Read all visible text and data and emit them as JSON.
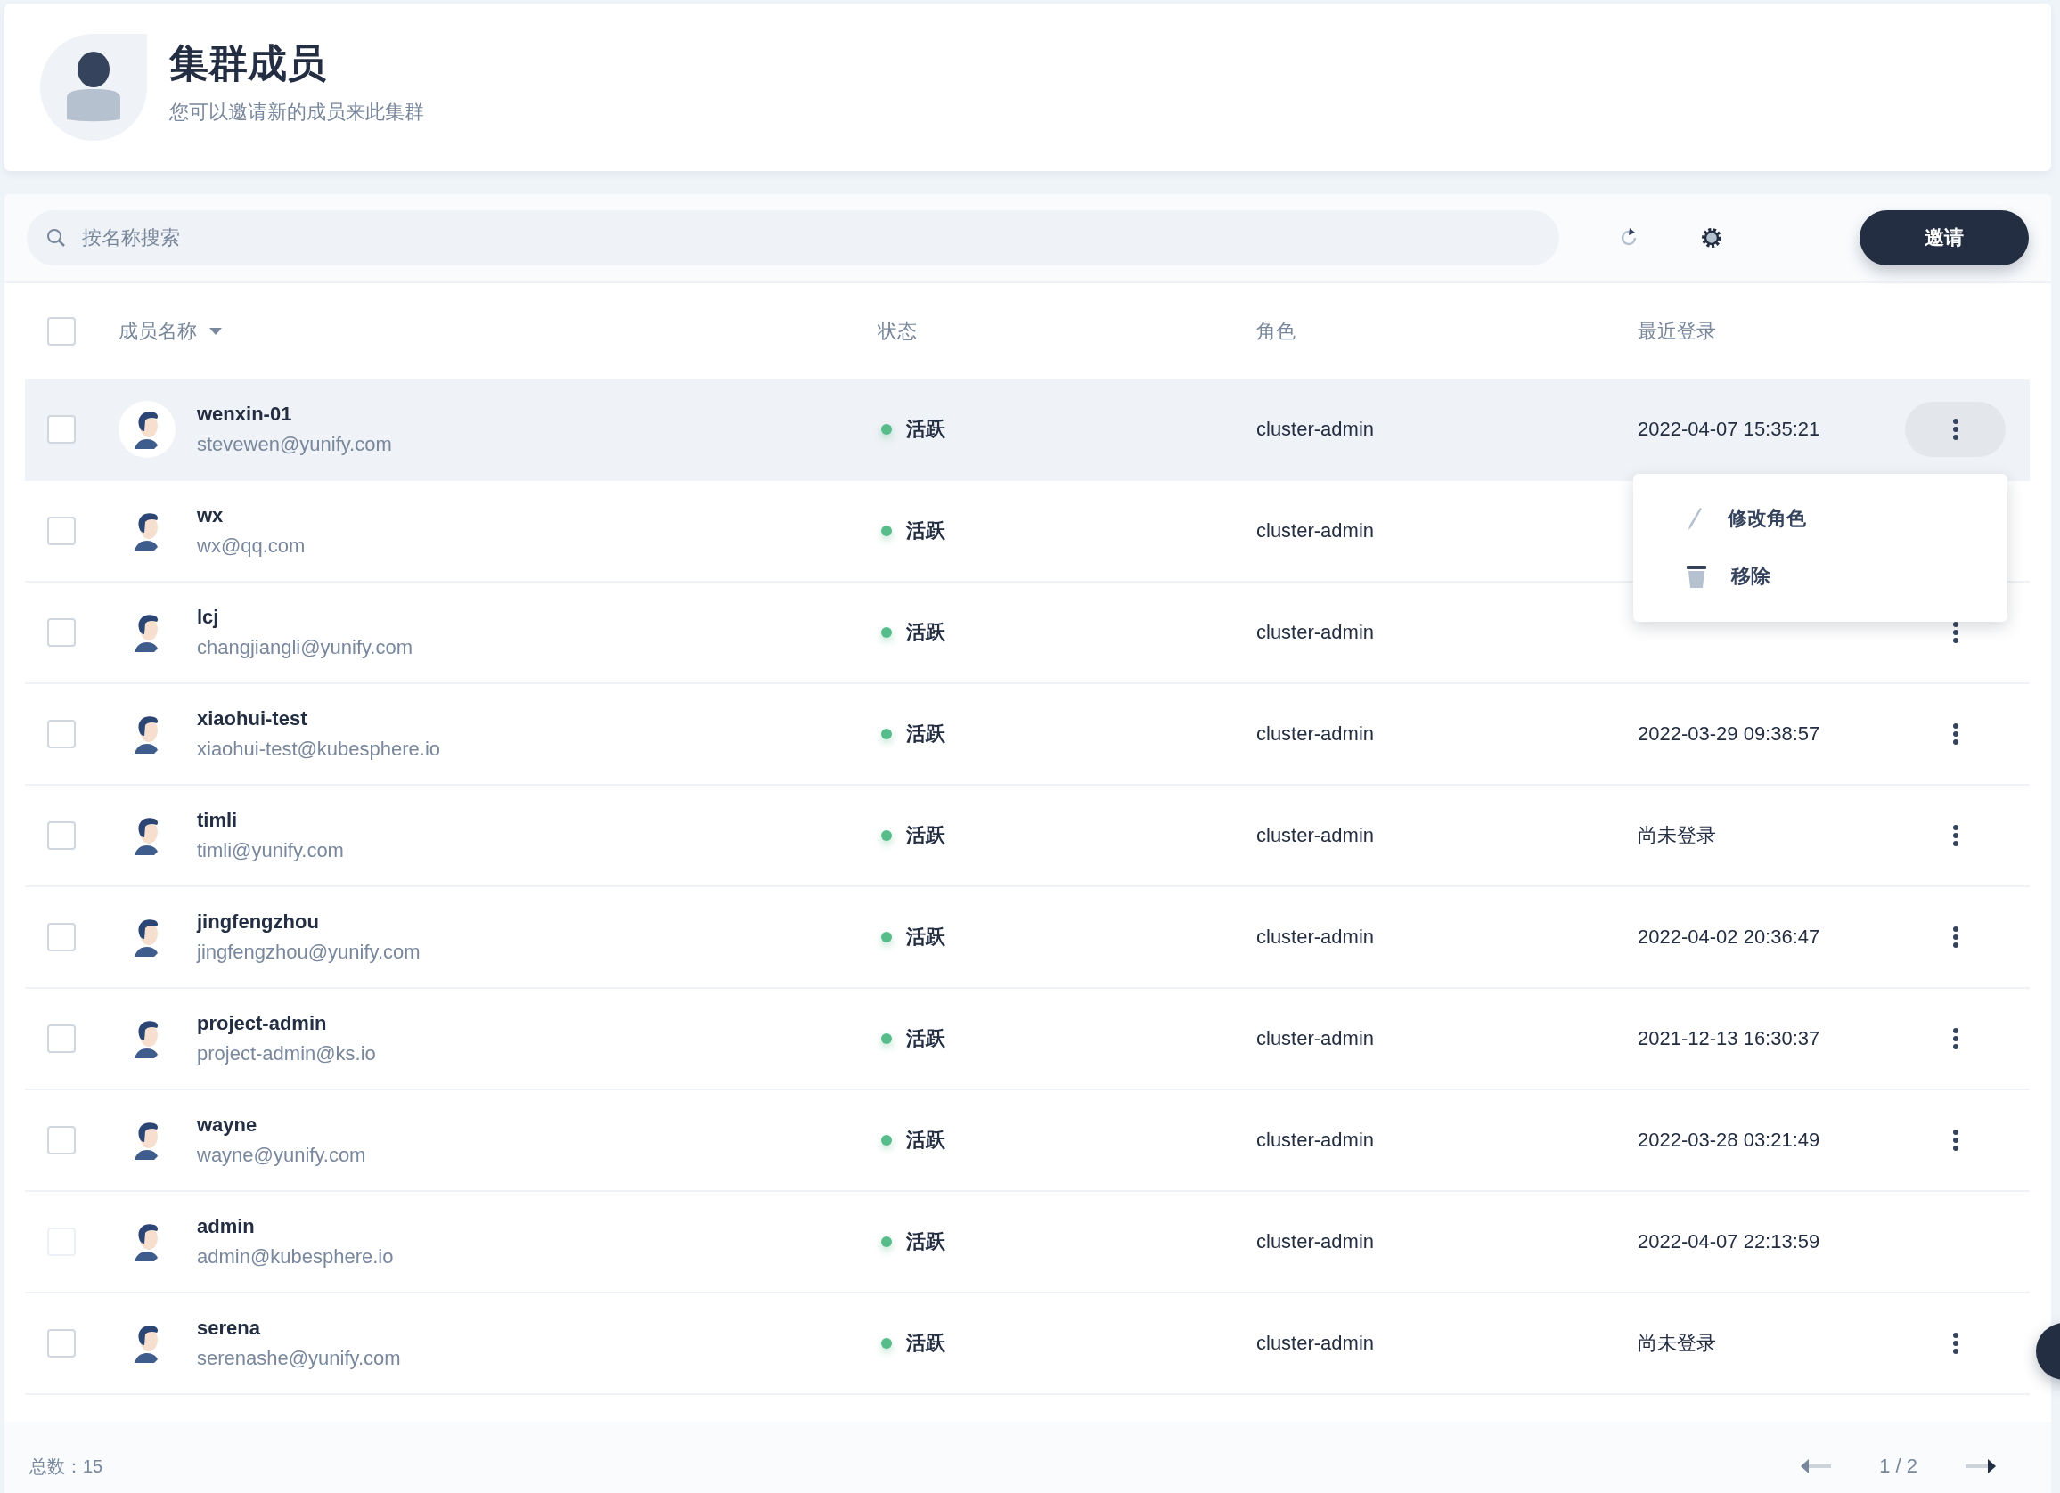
{
  "header": {
    "title": "集群成员",
    "subtitle": "您可以邀请新的成员来此集群"
  },
  "toolbar": {
    "search_placeholder": "按名称搜索",
    "invite_button": "邀请"
  },
  "table": {
    "select_all": {
      "checked": false
    },
    "columns": [
      {
        "label": "成员名称",
        "sortable": true
      },
      {
        "label": "状态",
        "sortable": false
      },
      {
        "label": "角色",
        "sortable": false
      },
      {
        "label": "最近登录",
        "sortable": false
      }
    ],
    "rows": [
      {
        "name": "wenxin-01",
        "email": "stevewen@yunify.com",
        "status": "活跃",
        "role": "cluster-admin",
        "last_login": "2022-04-07 15:35:21",
        "checked": false,
        "disabled": false,
        "highlighted": true,
        "actions": true,
        "menu": [
          {
            "kind": "edit",
            "label": "修改角色"
          },
          {
            "kind": "delete",
            "label": "移除"
          }
        ]
      },
      {
        "name": "wx",
        "email": "wx@qq.com",
        "status": "活跃",
        "role": "cluster-admin",
        "checked": false,
        "disabled": false,
        "highlighted": false,
        "actions": false
      },
      {
        "name": "lcj",
        "email": "changjiangli@yunify.com",
        "status": "活跃",
        "role": "cluster-admin",
        "checked": false,
        "disabled": false,
        "highlighted": false,
        "actions": true
      },
      {
        "name": "xiaohui-test",
        "email": "xiaohui-test@kubesphere.io",
        "status": "活跃",
        "role": "cluster-admin",
        "last_login": "2022-03-29 09:38:57",
        "checked": false,
        "disabled": false,
        "highlighted": false,
        "actions": true
      },
      {
        "name": "timli",
        "email": "timli@yunify.com",
        "status": "活跃",
        "role": "cluster-admin",
        "last_login": "尚未登录",
        "checked": false,
        "disabled": false,
        "highlighted": false,
        "actions": true
      },
      {
        "name": "jingfengzhou",
        "email": "jingfengzhou@yunify.com",
        "status": "活跃",
        "role": "cluster-admin",
        "last_login": "2022-04-02 20:36:47",
        "checked": false,
        "disabled": false,
        "highlighted": false,
        "actions": true
      },
      {
        "name": "project-admin",
        "email": "project-admin@ks.io",
        "status": "活跃",
        "role": "cluster-admin",
        "last_login": "2021-12-13 16:30:37",
        "checked": false,
        "disabled": false,
        "highlighted": false,
        "actions": true
      },
      {
        "name": "wayne",
        "email": "wayne@yunify.com",
        "status": "活跃",
        "role": "cluster-admin",
        "last_login": "2022-03-28 03:21:49",
        "checked": false,
        "disabled": false,
        "highlighted": false,
        "actions": true
      },
      {
        "name": "admin",
        "email": "admin@kubesphere.io",
        "status": "活跃",
        "role": "cluster-admin",
        "last_login": "2022-04-07 22:13:59",
        "checked": false,
        "disabled": true,
        "highlighted": false,
        "actions": false
      },
      {
        "name": "serena",
        "email": "serenashe@yunify.com",
        "status": "活跃",
        "role": "cluster-admin",
        "last_login": "尚未登录",
        "checked": false,
        "disabled": false,
        "highlighted": false,
        "actions": true
      }
    ]
  },
  "footer": {
    "total": "总数：15",
    "page": "1 / 2"
  }
}
